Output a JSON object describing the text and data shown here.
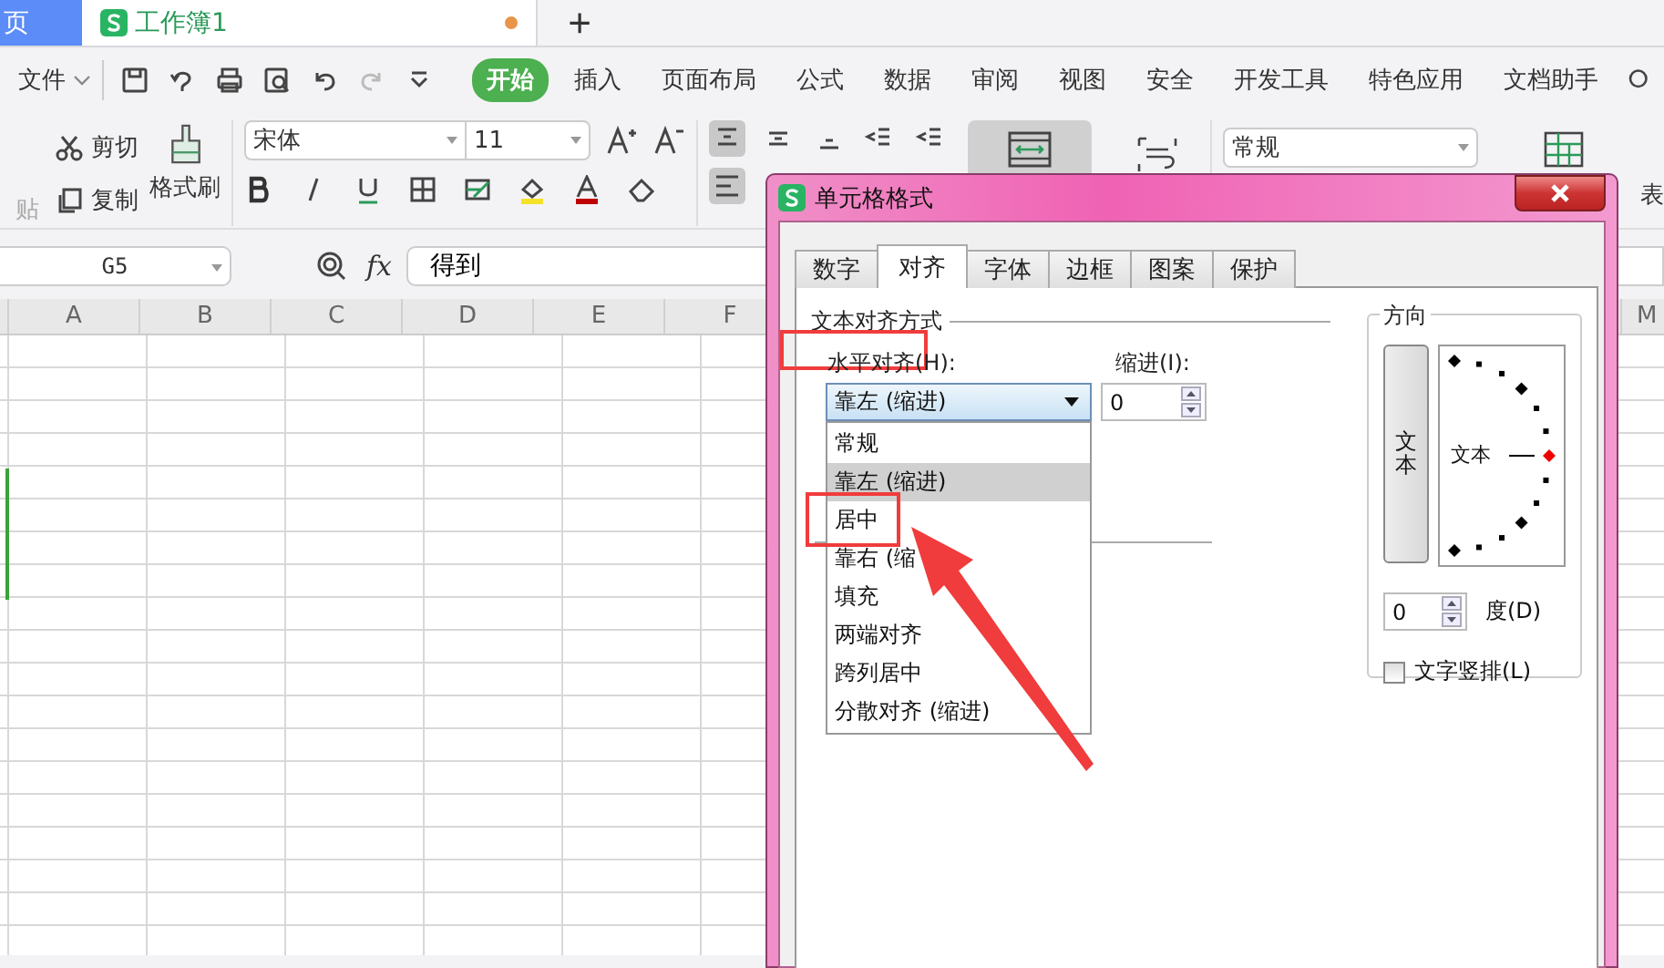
{
  "tabs": [
    {
      "label": "页",
      "kind": "home"
    },
    {
      "label": "工作簿1",
      "kind": "doc",
      "modified": true
    }
  ],
  "new_tab": "+",
  "menu": {
    "file": "文件",
    "tabs": [
      {
        "label": "开始",
        "selected": true
      },
      {
        "label": "插入",
        "selected": false
      },
      {
        "label": "页面布局",
        "selected": false
      },
      {
        "label": "公式",
        "selected": false
      },
      {
        "label": "数据",
        "selected": false
      },
      {
        "label": "审阅",
        "selected": false
      },
      {
        "label": "视图",
        "selected": false
      },
      {
        "label": "安全",
        "selected": false
      },
      {
        "label": "开发工具",
        "selected": false
      },
      {
        "label": "特色应用",
        "selected": false
      },
      {
        "label": "文档助手",
        "selected": false
      }
    ]
  },
  "ribbon": {
    "paste": "贴",
    "cut": "剪切",
    "copy": "复制",
    "format_painter": "格式刷",
    "font": "宋体",
    "size": "11",
    "number_format": "常规",
    "table_label": "表"
  },
  "formula_bar": {
    "cell": "G5",
    "fx": "fx",
    "value": "得到"
  },
  "columns": [
    "A",
    "B",
    "C",
    "D",
    "E",
    "F"
  ],
  "column_right": "M",
  "dialog": {
    "title": "单元格格式",
    "tabs": [
      {
        "label": "数字",
        "selected": false
      },
      {
        "label": "对齐",
        "selected": true
      },
      {
        "label": "字体",
        "selected": false
      },
      {
        "label": "边框",
        "selected": false
      },
      {
        "label": "图案",
        "selected": false
      },
      {
        "label": "保护",
        "selected": false
      }
    ],
    "group_title": "文本对齐方式",
    "horizontal_label": "水平对齐(H):",
    "indent_label": "缩进(I):",
    "horizontal_value": "靠左 (缩进)",
    "indent_value": "0",
    "options": [
      {
        "label": "常规",
        "selected": false
      },
      {
        "label": "靠左 (缩进)",
        "selected": true
      },
      {
        "label": "居中",
        "selected": false
      },
      {
        "label": "靠右 (缩",
        "selected": false
      },
      {
        "label": "填充",
        "selected": false
      },
      {
        "label": "两端对齐",
        "selected": false
      },
      {
        "label": "跨列居中",
        "selected": false
      },
      {
        "label": "分散对齐 (缩进)",
        "selected": false
      }
    ],
    "orientation": {
      "title": "方向",
      "vertical_text": "文本",
      "dial_text": "文本",
      "degrees": "0",
      "degrees_label": "度(D)",
      "stacked": {
        "label": "文字竖排(L)",
        "checked": false
      }
    }
  }
}
